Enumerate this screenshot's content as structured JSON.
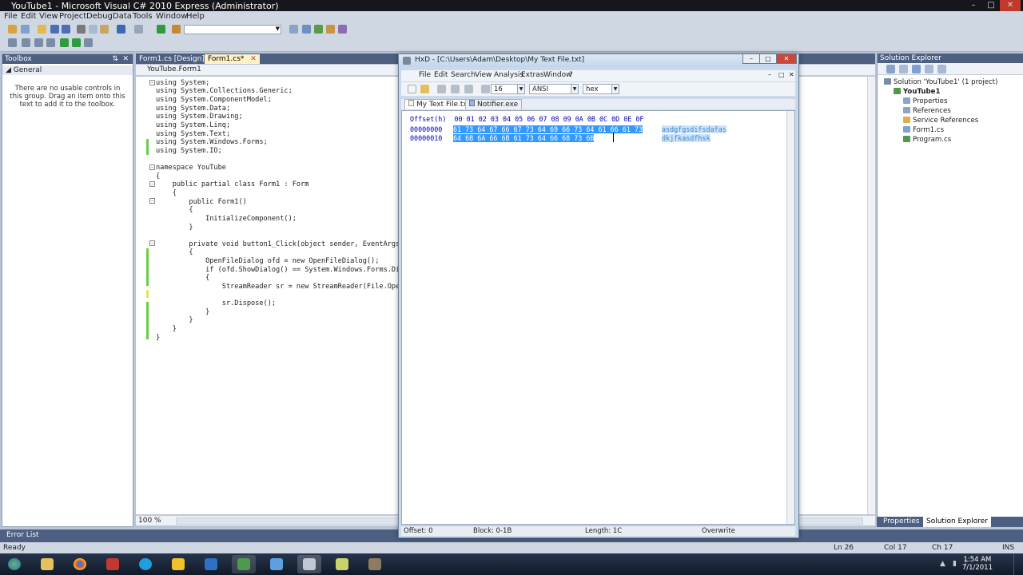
{
  "vs": {
    "title": "YouTube1 - Microsoft Visual C# 2010 Express (Administrator)",
    "menu": [
      "File",
      "Edit",
      "View",
      "Project",
      "Debug",
      "Data",
      "Tools",
      "Window",
      "Help"
    ],
    "toolbox": {
      "title": "Toolbox",
      "group": "General",
      "message": "There are no usable controls in this group. Drag an item onto this text to add it to the toolbox."
    },
    "tabs": [
      "Form1.cs [Design]*",
      "Form1.cs*"
    ],
    "active_tab": "Form1.cs*",
    "nav_class": "YouTube.Form1",
    "code": [
      "using System;",
      "using System.Collections.Generic;",
      "using System.ComponentModel;",
      "using System.Data;",
      "using System.Drawing;",
      "using System.Linq;",
      "using System.Text;",
      "using System.Windows.Forms;",
      "using System.IO;",
      "",
      "namespace YouTube",
      "{",
      "    public partial class Form1 : Form",
      "    {",
      "        public Form1()",
      "        {",
      "            InitializeComponent();",
      "        }",
      "",
      "        private void button1_Click(object sender, EventArgs e)",
      "        {",
      "            OpenFileDialog ofd = new OpenFileDialog();",
      "            if (ofd.ShowDialog() == System.Windows.Forms.DialogRe",
      "            {",
      "                StreamReader sr = new StreamReader(File.OpenRead(",
      "",
      "                sr.Dispose();",
      "            }",
      "        }",
      "}"
    ],
    "zoom": "100 %",
    "solution_explorer": {
      "title": "Solution Explorer",
      "items": [
        "Solution 'YouTube1' (1 project)",
        "YouTube1",
        "Properties",
        "References",
        "Service References",
        "Form1.cs",
        "Program.cs"
      ],
      "tabs": [
        "Properties",
        "Solution Explorer"
      ]
    },
    "error_list": "Error List",
    "status": {
      "ready": "Ready",
      "ln": "Ln 26",
      "col": "Col 17",
      "ch": "Ch 17",
      "ins": "INS"
    }
  },
  "hxd": {
    "title": "HxD - [C:\\Users\\Adam\\Desktop\\My Text File.txt]",
    "menu": [
      "File",
      "Edit",
      "Search",
      "View",
      "Analysis",
      "Extras",
      "Window",
      "?"
    ],
    "bytes_per_row": "16",
    "charset": "ANSI",
    "display": "hex",
    "tabs": [
      "My Text File.txt",
      "Notifier.exe"
    ],
    "header": "Offset(h)  00 01 02 03 04 05 06 07 08 09 0A 0B 0C 0D 0E 0F",
    "rows": [
      {
        "offset": "00000000",
        "hex": "61 73 64 67 66 67 73 64 69 66 73 64 61 66 61 73",
        "ascii": "asdgfgsdifsdafas"
      },
      {
        "offset": "00000010",
        "hex": "64 6B 6A 66 6B 61 73 64 66 68 73 6B",
        "ascii": "dkjfkasdfhsk"
      }
    ],
    "status": {
      "offset": "Offset: 0",
      "block": "Block: 0-1B",
      "length": "Length: 1C",
      "mode": "Overwrite"
    }
  },
  "taskbar": {
    "time": "1:54 AM",
    "date": "7/1/2011"
  }
}
